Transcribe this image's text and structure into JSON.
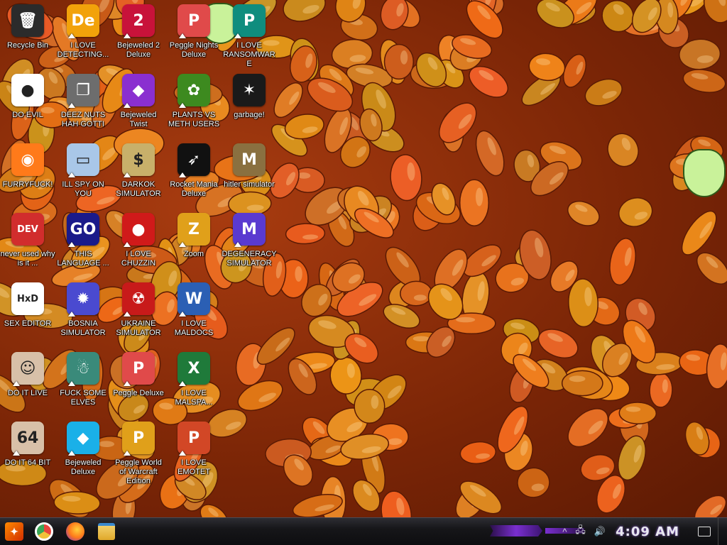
{
  "desktop": {
    "icons": [
      {
        "label": "Recycle Bin",
        "icon": "recycle-bin-icon",
        "color": "#2b2b2b",
        "glyph": "🗑",
        "shortcut": false
      },
      {
        "label": "I LOVE DETECTING...",
        "icon": "detective-icon",
        "color": "#f2a20a",
        "glyph": "De",
        "shortcut": true
      },
      {
        "label": "Bejeweled 2 Deluxe",
        "icon": "bejeweled-2-icon",
        "color": "#c8123a",
        "glyph": "2",
        "shortcut": true
      },
      {
        "label": "Peggle Nights Deluxe",
        "icon": "peggle-nights-icon",
        "color": "#e04a4a",
        "glyph": "P",
        "shortcut": true
      },
      {
        "label": "I LOVE RANSOMWARE",
        "icon": "publisher-icon",
        "color": "#0f8d7e",
        "glyph": "P",
        "shortcut": true
      },
      {
        "label": "DO EVIL",
        "icon": "chrome-icon",
        "color": "#ffffff",
        "glyph": "●",
        "shortcut": false
      },
      {
        "label": "DEEZ NUTS HAH GOTTI",
        "icon": "copy-icon",
        "color": "#6d6d6d",
        "glyph": "❐",
        "shortcut": true
      },
      {
        "label": "Bejeweled Twist",
        "icon": "bejeweled-twist-icon",
        "color": "#8a2fd0",
        "glyph": "◆",
        "shortcut": true
      },
      {
        "label": "PLANTS VS METH USERS",
        "icon": "plants-vs-zombies-icon",
        "color": "#3d8a1f",
        "glyph": "✿",
        "shortcut": true
      },
      {
        "label": "garbage!",
        "icon": "garbage-icon",
        "color": "#1a1a1a",
        "glyph": "✶",
        "shortcut": false
      },
      {
        "label": "FURRYFUCK!",
        "icon": "firefox-icon",
        "color": "#ff7a1a",
        "glyph": "◉",
        "shortcut": false
      },
      {
        "label": "ILL SPY ON YOU",
        "icon": "network-icon",
        "color": "#a9c7e8",
        "glyph": "▭",
        "shortcut": true
      },
      {
        "label": "DARKOK SIMULATOR",
        "icon": "money-bag-icon",
        "color": "#c8b06a",
        "glyph": "$",
        "shortcut": true
      },
      {
        "label": "Rocket Mania Deluxe",
        "icon": "rocket-mania-icon",
        "color": "#111111",
        "glyph": "➶",
        "shortcut": true
      },
      {
        "label": "hitler simulator",
        "icon": "medal-icon",
        "color": "#8a7040",
        "glyph": "M",
        "shortcut": false
      },
      {
        "label": "never used why is it ...",
        "icon": "dev-cpp-icon",
        "color": "#d12d2d",
        "glyph": "DEV",
        "shortcut": false
      },
      {
        "label": "THIS LANGUAGE ...",
        "icon": "goland-icon",
        "color": "#1a1a8a",
        "glyph": "GO",
        "shortcut": true
      },
      {
        "label": "I LOVE CHUZZIN",
        "icon": "chuzzle-icon",
        "color": "#d01a1a",
        "glyph": "●",
        "shortcut": true
      },
      {
        "label": "Zoom",
        "icon": "zuma-icon",
        "color": "#e0a01a",
        "glyph": "Z",
        "shortcut": true
      },
      {
        "label": "DEGENERACY SIMULATOR",
        "icon": "degeneracy-icon",
        "color": "#5a3ad0",
        "glyph": "M",
        "shortcut": true
      },
      {
        "label": "SEX EDITOR",
        "icon": "hxd-icon",
        "color": "#ffffff",
        "glyph": "HxD",
        "shortcut": false
      },
      {
        "label": "BOSNIA SIMULATOR",
        "icon": "mine-icon",
        "color": "#4a4ad0",
        "glyph": "✹",
        "shortcut": true
      },
      {
        "label": "UKRAINE SIMULATOR",
        "icon": "radiation-icon",
        "color": "#c81a1a",
        "glyph": "☢",
        "shortcut": true
      },
      {
        "label": "I LOVE MALDOCS",
        "icon": "word-icon",
        "color": "#2b5fb4",
        "glyph": "W",
        "shortcut": true
      },
      {
        "label": "DO IT LIVE",
        "icon": "portrait-icon",
        "color": "#d8c0a8",
        "glyph": "☺",
        "shortcut": true
      },
      {
        "label": "FUCK SOME ELVES",
        "icon": "santa-icon",
        "color": "#3a8a7a",
        "glyph": "☃",
        "shortcut": true
      },
      {
        "label": "Peggle Deluxe",
        "icon": "peggle-icon",
        "color": "#e04a4a",
        "glyph": "P",
        "shortcut": true
      },
      {
        "label": "I LOVE MALSPA...",
        "icon": "excel-icon",
        "color": "#1f7a3a",
        "glyph": "X",
        "shortcut": true
      },
      {
        "label": "DO IT 64 BIT",
        "icon": "portrait-64-icon",
        "color": "#d8c0a8",
        "glyph": "64",
        "shortcut": true
      },
      {
        "label": "Bejeweled Deluxe",
        "icon": "diamond-icon",
        "color": "#1ab0e8",
        "glyph": "◆",
        "shortcut": true
      },
      {
        "label": "Peggle World of Warcraft Edition",
        "icon": "peggle-wow-icon",
        "color": "#e0a01a",
        "glyph": "P",
        "shortcut": true
      },
      {
        "label": "I LOVE EMOTET",
        "icon": "powerpoint-icon",
        "color": "#d24726",
        "glyph": "P",
        "shortcut": true
      }
    ]
  },
  "taskbar": {
    "start_glyph": "✦",
    "pinned": [
      {
        "name": "chrome-taskbar-icon",
        "color": "#e8453c"
      },
      {
        "name": "firefox-taskbar-icon",
        "color": "#ff7a1a"
      },
      {
        "name": "file-explorer-taskbar-icon",
        "color": "#f2c23a"
      }
    ],
    "tray": {
      "chevron": "^",
      "network": "🖧",
      "volume": "🔊",
      "clock": "4:09 AM"
    }
  }
}
